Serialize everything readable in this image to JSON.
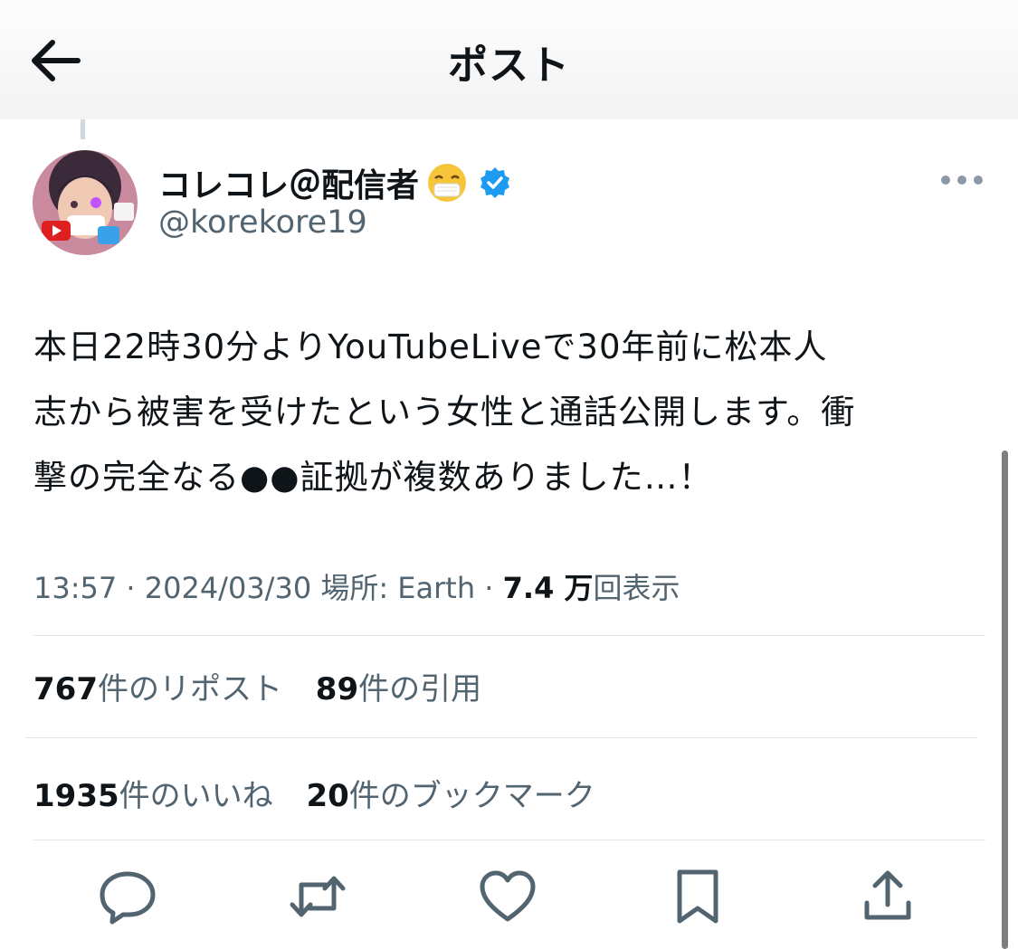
{
  "header": {
    "title": "ポスト",
    "back_icon": "arrow-left-icon"
  },
  "user": {
    "display_name": "コレコレ＠配信者",
    "emoji": "mask-face-emoji",
    "verified_icon": "verified-badge-icon",
    "handle": "@korekore19"
  },
  "post": {
    "lines": [
      "本日22時30分よりYouTubeLiveで30年前に松本人",
      "志から被害を受けたという女性と通話公開します。衝",
      "撃の完全なる●●証拠が複数ありました…！"
    ],
    "time": "13:57",
    "date": "2024/03/30",
    "location": "場所: Earth",
    "views_count": "7.4 万",
    "views_label": "回表示"
  },
  "stats": {
    "reposts_count": "767",
    "reposts_label": "件のリポスト",
    "quotes_count": "89",
    "quotes_label": "件の引用",
    "likes_count": "1935",
    "likes_label": "件のいいね",
    "bookmarks_count": "20",
    "bookmarks_label": "件のブックマーク"
  },
  "actions": [
    "reply-icon",
    "repost-icon",
    "like-icon",
    "bookmark-icon",
    "share-icon"
  ],
  "colors": {
    "verified": "#1d9bf0",
    "secondary_text": "#536471",
    "primary_text": "#0f1419"
  }
}
